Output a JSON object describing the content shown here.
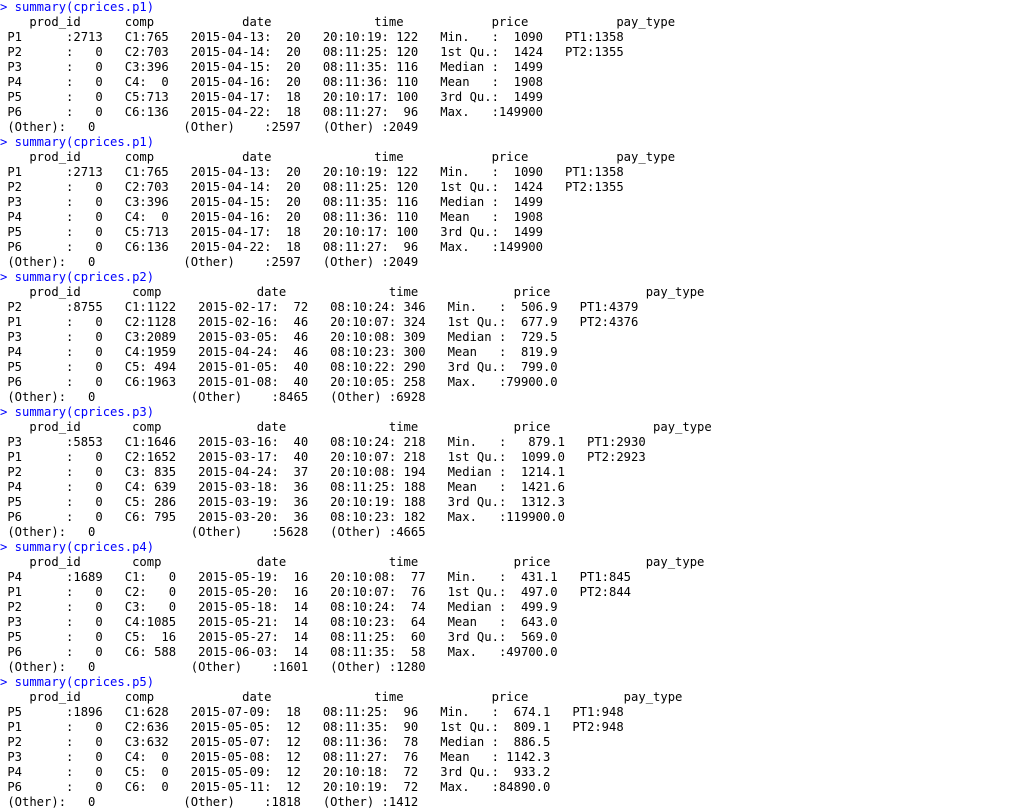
{
  "console": {
    "command_color": "#0000ff",
    "lines": [
      {
        "kind": "cmd",
        "text": "> summary(cprices.p1)"
      },
      {
        "kind": "out",
        "text": "    prod_id      comp            date              time            price            pay_type"
      },
      {
        "kind": "out",
        "text": " P1      :2713   C1:765   2015-04-13:  20   20:10:19: 122   Min.   :  1090   PT1:1358"
      },
      {
        "kind": "out",
        "text": " P2      :   0   C2:703   2015-04-14:  20   08:11:25: 120   1st Qu.:  1424   PT2:1355"
      },
      {
        "kind": "out",
        "text": " P3      :   0   C3:396   2015-04-15:  20   08:11:35: 116   Median :  1499"
      },
      {
        "kind": "out",
        "text": " P4      :   0   C4:  0   2015-04-16:  20   08:11:36: 110   Mean   :  1908"
      },
      {
        "kind": "out",
        "text": " P5      :   0   C5:713   2015-04-17:  18   20:10:17: 100   3rd Qu.:  1499"
      },
      {
        "kind": "out",
        "text": " P6      :   0   C6:136   2015-04-22:  18   08:11:27:  96   Max.   :149900"
      },
      {
        "kind": "out",
        "text": " (Other):   0            (Other)    :2597   (Other) :2049"
      },
      {
        "kind": "cmd",
        "text": "> summary(cprices.p1)"
      },
      {
        "kind": "out",
        "text": "    prod_id      comp            date              time            price            pay_type"
      },
      {
        "kind": "out",
        "text": " P1      :2713   C1:765   2015-04-13:  20   20:10:19: 122   Min.   :  1090   PT1:1358"
      },
      {
        "kind": "out",
        "text": " P2      :   0   C2:703   2015-04-14:  20   08:11:25: 120   1st Qu.:  1424   PT2:1355"
      },
      {
        "kind": "out",
        "text": " P3      :   0   C3:396   2015-04-15:  20   08:11:35: 116   Median :  1499"
      },
      {
        "kind": "out",
        "text": " P4      :   0   C4:  0   2015-04-16:  20   08:11:36: 110   Mean   :  1908"
      },
      {
        "kind": "out",
        "text": " P5      :   0   C5:713   2015-04-17:  18   20:10:17: 100   3rd Qu.:  1499"
      },
      {
        "kind": "out",
        "text": " P6      :   0   C6:136   2015-04-22:  18   08:11:27:  96   Max.   :149900"
      },
      {
        "kind": "out",
        "text": " (Other):   0            (Other)    :2597   (Other) :2049"
      },
      {
        "kind": "cmd",
        "text": "> summary(cprices.p2)"
      },
      {
        "kind": "out",
        "text": "    prod_id       comp             date              time             price             pay_type"
      },
      {
        "kind": "out",
        "text": " P2      :8755   C1:1122   2015-02-17:  72   08:10:24: 346   Min.   :  506.9   PT1:4379"
      },
      {
        "kind": "out",
        "text": " P1      :   0   C2:1128   2015-02-16:  46   20:10:07: 324   1st Qu.:  677.9   PT2:4376"
      },
      {
        "kind": "out",
        "text": " P3      :   0   C3:2089   2015-03-05:  46   20:10:08: 309   Median :  729.5"
      },
      {
        "kind": "out",
        "text": " P4      :   0   C4:1959   2015-04-24:  46   08:10:23: 300   Mean   :  819.9"
      },
      {
        "kind": "out",
        "text": " P5      :   0   C5: 494   2015-01-05:  40   08:10:22: 290   3rd Qu.:  799.0"
      },
      {
        "kind": "out",
        "text": " P6      :   0   C6:1963   2015-01-08:  40   20:10:05: 258   Max.   :79900.0"
      },
      {
        "kind": "out",
        "text": " (Other):   0             (Other)    :8465   (Other) :6928"
      },
      {
        "kind": "cmd",
        "text": "> summary(cprices.p3)"
      },
      {
        "kind": "out",
        "text": "    prod_id       comp             date              time             price              pay_type"
      },
      {
        "kind": "out",
        "text": " P3      :5853   C1:1646   2015-03-16:  40   08:10:24: 218   Min.   :   879.1   PT1:2930"
      },
      {
        "kind": "out",
        "text": " P1      :   0   C2:1652   2015-03-17:  40   20:10:07: 218   1st Qu.:  1099.0   PT2:2923"
      },
      {
        "kind": "out",
        "text": " P2      :   0   C3: 835   2015-04-24:  37   20:10:08: 194   Median :  1214.1"
      },
      {
        "kind": "out",
        "text": " P4      :   0   C4: 639   2015-03-18:  36   08:11:25: 188   Mean   :  1421.6"
      },
      {
        "kind": "out",
        "text": " P5      :   0   C5: 286   2015-03-19:  36   20:10:19: 188   3rd Qu.:  1312.3"
      },
      {
        "kind": "out",
        "text": " P6      :   0   C6: 795   2015-03-20:  36   08:10:23: 182   Max.   :119900.0"
      },
      {
        "kind": "out",
        "text": " (Other):   0             (Other)    :5628   (Other) :4665"
      },
      {
        "kind": "cmd",
        "text": "> summary(cprices.p4)"
      },
      {
        "kind": "out",
        "text": "    prod_id       comp             date              time             price             pay_type"
      },
      {
        "kind": "out",
        "text": " P4      :1689   C1:   0   2015-05-19:  16   20:10:08:  77   Min.   :  431.1   PT1:845"
      },
      {
        "kind": "out",
        "text": " P1      :   0   C2:   0   2015-05-20:  16   20:10:07:  76   1st Qu.:  497.0   PT2:844"
      },
      {
        "kind": "out",
        "text": " P2      :   0   C3:   0   2015-05-18:  14   08:10:24:  74   Median :  499.9"
      },
      {
        "kind": "out",
        "text": " P3      :   0   C4:1085   2015-05-21:  14   08:10:23:  64   Mean   :  643.0"
      },
      {
        "kind": "out",
        "text": " P5      :   0   C5:  16   2015-05-27:  14   08:11:25:  60   3rd Qu.:  569.0"
      },
      {
        "kind": "out",
        "text": " P6      :   0   C6: 588   2015-06-03:  14   08:11:35:  58   Max.   :49700.0"
      },
      {
        "kind": "out",
        "text": " (Other):   0             (Other)    :1601   (Other) :1280"
      },
      {
        "kind": "cmd",
        "text": "> summary(cprices.p5)"
      },
      {
        "kind": "out",
        "text": "    prod_id      comp            date              time            price             pay_type"
      },
      {
        "kind": "out",
        "text": " P5      :1896   C1:628   2015-07-09:  18   08:11:25:  96   Min.   :  674.1   PT1:948"
      },
      {
        "kind": "out",
        "text": " P1      :   0   C2:636   2015-05-05:  12   08:11:35:  90   1st Qu.:  809.1   PT2:948"
      },
      {
        "kind": "out",
        "text": " P2      :   0   C3:632   2015-05-07:  12   08:11:36:  78   Median :  886.5"
      },
      {
        "kind": "out",
        "text": " P3      :   0   C4:  0   2015-05-08:  12   08:11:27:  76   Mean   : 1142.3"
      },
      {
        "kind": "out",
        "text": " P4      :   0   C5:  0   2015-05-09:  12   20:10:18:  72   3rd Qu.:  933.2"
      },
      {
        "kind": "out",
        "text": " P6      :   0   C6:  0   2015-05-11:  12   20:10:19:  72   Max.   :84890.0"
      },
      {
        "kind": "out",
        "text": " (Other):   0            (Other)    :1818   (Other) :1412"
      }
    ]
  }
}
